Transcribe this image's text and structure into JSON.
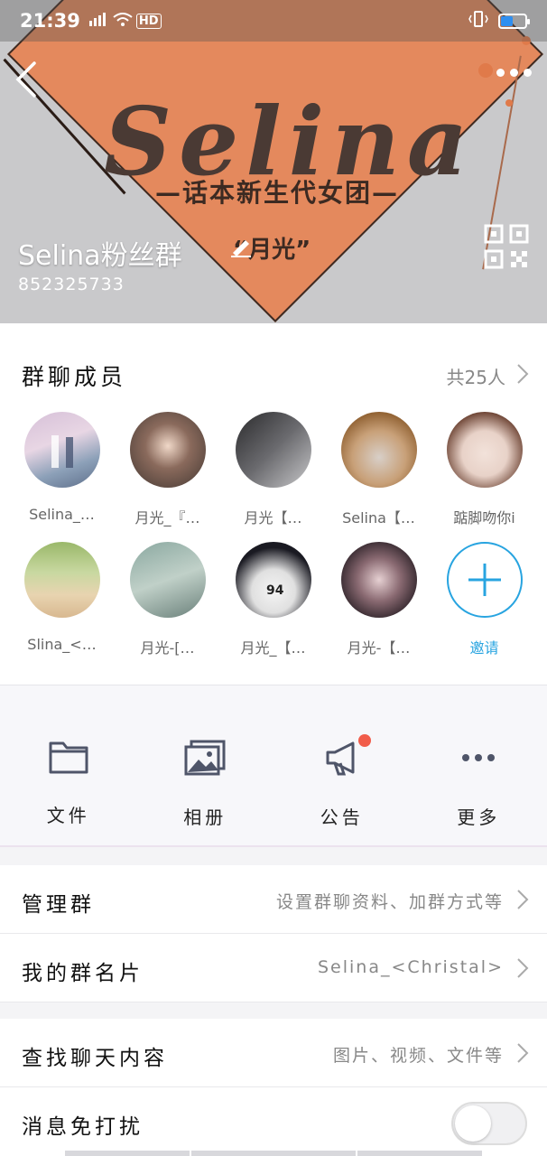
{
  "status_bar": {
    "time": "21:39",
    "network": "4G",
    "hd": "HD"
  },
  "banner": {
    "brand_text": "Selina",
    "tagline": "—话本新生代女团—",
    "moon_text": "“月光”"
  },
  "group": {
    "name": "Selina粉丝群",
    "id": "852325733"
  },
  "members": {
    "title": "群聊成员",
    "count": "共25人",
    "items": [
      {
        "name": "Selina_…"
      },
      {
        "name": "月光_『…"
      },
      {
        "name": "月光【…"
      },
      {
        "name": "Selina【…"
      },
      {
        "name": "踮脚吻你i"
      },
      {
        "name": "Slina_<…"
      },
      {
        "name": "月光-[…"
      },
      {
        "name": "月光_【…"
      },
      {
        "name": "月光-【…"
      }
    ],
    "invite_label": "邀请"
  },
  "functions": [
    {
      "label": "文件",
      "icon": "folder-icon"
    },
    {
      "label": "相册",
      "icon": "album-icon"
    },
    {
      "label": "公告",
      "icon": "megaphone-icon"
    },
    {
      "label": "更多",
      "icon": "more-dots-icon"
    }
  ],
  "rows": {
    "manage": {
      "title": "管理群",
      "value": "设置群聊资料、加群方式等"
    },
    "card": {
      "title": "我的群名片",
      "value": "Selina_<Christal>"
    },
    "search": {
      "title": "查找聊天内容",
      "value": "图片、视频、文件等"
    },
    "dnd": {
      "title": "消息免打扰",
      "enabled": false
    }
  },
  "colors": {
    "accent": "#28a4e0",
    "badge": "#f15c4a",
    "banner_orange": "#e4895d"
  }
}
